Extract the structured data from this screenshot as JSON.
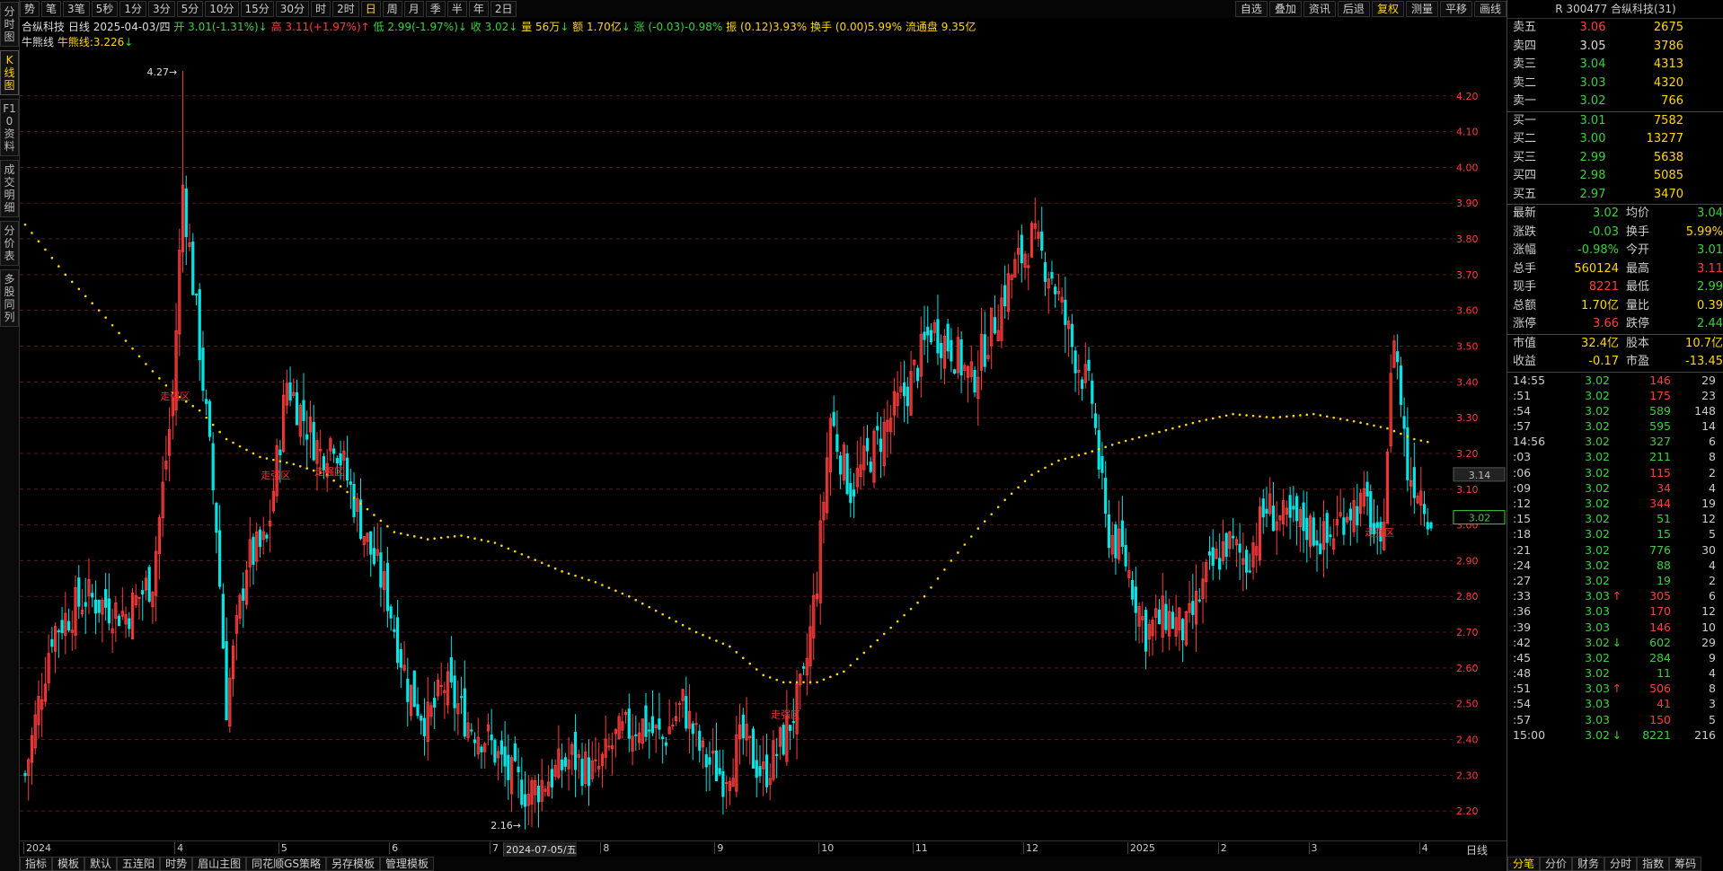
{
  "left_tabs": [
    {
      "label": "分时图",
      "active": false
    },
    {
      "label": "K线图",
      "active": true
    },
    {
      "label": "F10资料",
      "active": false
    },
    {
      "label": "成交明细",
      "active": false
    },
    {
      "label": "分价表",
      "active": false
    },
    {
      "label": "多股同列",
      "active": false
    }
  ],
  "toolbar": {
    "periods": [
      "势",
      "笔",
      "3笔",
      "5秒",
      "1分",
      "3分",
      "5分",
      "10分",
      "15分",
      "30分",
      "时",
      "2时",
      "日",
      "周",
      "月",
      "季",
      "半",
      "年",
      "2日"
    ],
    "active_period": "日",
    "right": [
      "自选",
      "叠加",
      "资讯",
      "后退",
      "复权",
      "测量",
      "平移",
      "画线"
    ],
    "highlight": "复权"
  },
  "info": {
    "name": "合纵科技",
    "period": "日线",
    "date": "2025-04-03/四",
    "open": "开 3.01(-1.31%)",
    "high": "高 3.11(+1.97%)",
    "low": "低 2.99(-1.97%)",
    "close": "收 3.02",
    "volume": "量 56万",
    "amount": "额 1.70亿",
    "change": "涨 (-0.03)-0.98%",
    "amplitude": "振 (0.12)3.93%",
    "turnover": "换手 (0.00)5.99%",
    "float": "流通盘 9.35亿",
    "indicator_name": "牛熊线",
    "indicator_value": "牛熊线:3.226"
  },
  "chart_data": {
    "type": "candlestick",
    "ylim": [
      2.12,
      4.33
    ],
    "y_ticks": [
      "4.20",
      "4.10",
      "4.00",
      "3.90",
      "3.80",
      "3.70",
      "3.60",
      "3.50",
      "3.40",
      "3.30",
      "3.20",
      "3.10",
      "3.00",
      "2.90",
      "2.80",
      "2.70",
      "2.60",
      "2.50",
      "2.40",
      "2.30",
      "2.20"
    ],
    "x_labels": [
      {
        "label": "2024",
        "idx": 0
      },
      {
        "label": "4",
        "idx": 45
      },
      {
        "label": "5",
        "idx": 76
      },
      {
        "label": "6",
        "idx": 109
      },
      {
        "label": "7",
        "idx": 139
      },
      {
        "label": "2024-07-05/五",
        "idx": 143
      },
      {
        "label": "8",
        "idx": 172
      },
      {
        "label": "9",
        "idx": 206
      },
      {
        "label": "10",
        "idx": 237
      },
      {
        "label": "11",
        "idx": 265
      },
      {
        "label": "12",
        "idx": 298
      },
      {
        "label": "2025",
        "idx": 329
      },
      {
        "label": "2",
        "idx": 356
      },
      {
        "label": "3",
        "idx": 383
      },
      {
        "label": "4",
        "idx": 416
      }
    ],
    "n_bars": 420,
    "close_anchors": [
      [
        0,
        2.3
      ],
      [
        8,
        2.7
      ],
      [
        18,
        2.8
      ],
      [
        30,
        2.75
      ],
      [
        38,
        2.85
      ],
      [
        44,
        3.35
      ],
      [
        47,
        3.95
      ],
      [
        52,
        3.5
      ],
      [
        57,
        3.0
      ],
      [
        60,
        2.5
      ],
      [
        66,
        2.9
      ],
      [
        72,
        2.95
      ],
      [
        78,
        3.4
      ],
      [
        83,
        3.3
      ],
      [
        88,
        3.2
      ],
      [
        92,
        3.25
      ],
      [
        97,
        3.1
      ],
      [
        102,
        2.95
      ],
      [
        108,
        2.8
      ],
      [
        114,
        2.55
      ],
      [
        120,
        2.45
      ],
      [
        125,
        2.55
      ],
      [
        132,
        2.45
      ],
      [
        138,
        2.4
      ],
      [
        144,
        2.3
      ],
      [
        150,
        2.25
      ],
      [
        157,
        2.3
      ],
      [
        163,
        2.35
      ],
      [
        170,
        2.3
      ],
      [
        176,
        2.4
      ],
      [
        183,
        2.45
      ],
      [
        190,
        2.4
      ],
      [
        196,
        2.5
      ],
      [
        202,
        2.35
      ],
      [
        208,
        2.3
      ],
      [
        214,
        2.4
      ],
      [
        220,
        2.3
      ],
      [
        226,
        2.4
      ],
      [
        232,
        2.55
      ],
      [
        236,
        2.85
      ],
      [
        240,
        3.3
      ],
      [
        246,
        3.1
      ],
      [
        252,
        3.2
      ],
      [
        258,
        3.3
      ],
      [
        264,
        3.4
      ],
      [
        270,
        3.55
      ],
      [
        276,
        3.5
      ],
      [
        282,
        3.4
      ],
      [
        288,
        3.55
      ],
      [
        294,
        3.7
      ],
      [
        300,
        3.8
      ],
      [
        306,
        3.7
      ],
      [
        312,
        3.5
      ],
      [
        318,
        3.35
      ],
      [
        322,
        3.0
      ],
      [
        328,
        2.9
      ],
      [
        334,
        2.7
      ],
      [
        340,
        2.75
      ],
      [
        346,
        2.7
      ],
      [
        352,
        2.85
      ],
      [
        358,
        2.95
      ],
      [
        364,
        2.9
      ],
      [
        370,
        3.05
      ],
      [
        376,
        3.0
      ],
      [
        382,
        3.0
      ],
      [
        388,
        2.95
      ],
      [
        394,
        3.05
      ],
      [
        400,
        3.05
      ],
      [
        404,
        2.9
      ],
      [
        408,
        3.55
      ],
      [
        412,
        3.15
      ],
      [
        416,
        3.1
      ],
      [
        419,
        3.02
      ]
    ],
    "ma_anchors": [
      [
        0,
        3.84
      ],
      [
        12,
        3.7
      ],
      [
        24,
        3.58
      ],
      [
        36,
        3.45
      ],
      [
        44,
        3.37
      ],
      [
        52,
        3.32
      ],
      [
        60,
        3.24
      ],
      [
        70,
        3.19
      ],
      [
        80,
        3.17
      ],
      [
        90,
        3.14
      ],
      [
        100,
        3.06
      ],
      [
        110,
        2.98
      ],
      [
        120,
        2.96
      ],
      [
        130,
        2.97
      ],
      [
        140,
        2.95
      ],
      [
        150,
        2.91
      ],
      [
        160,
        2.87
      ],
      [
        170,
        2.84
      ],
      [
        180,
        2.8
      ],
      [
        190,
        2.75
      ],
      [
        200,
        2.7
      ],
      [
        210,
        2.66
      ],
      [
        220,
        2.58
      ],
      [
        226,
        2.56
      ],
      [
        236,
        2.56
      ],
      [
        244,
        2.59
      ],
      [
        252,
        2.66
      ],
      [
        260,
        2.73
      ],
      [
        268,
        2.8
      ],
      [
        276,
        2.9
      ],
      [
        284,
        2.99
      ],
      [
        292,
        3.07
      ],
      [
        300,
        3.14
      ],
      [
        308,
        3.18
      ],
      [
        316,
        3.2
      ],
      [
        326,
        3.23
      ],
      [
        338,
        3.26
      ],
      [
        350,
        3.29
      ],
      [
        360,
        3.31
      ],
      [
        372,
        3.3
      ],
      [
        384,
        3.31
      ],
      [
        396,
        3.29
      ],
      [
        406,
        3.27
      ],
      [
        414,
        3.24
      ],
      [
        419,
        3.23
      ]
    ],
    "high_label": "4.27",
    "low_label": "2.16",
    "zone_labels": [
      {
        "text": "走强区",
        "idx": 44,
        "price": 3.35
      },
      {
        "text": "走强区",
        "idx": 74,
        "price": 3.13
      },
      {
        "text": "走强区",
        "idx": 90,
        "price": 3.14
      },
      {
        "text": "走强区",
        "idx": 226,
        "price": 2.46
      },
      {
        "text": "走强区",
        "idx": 403,
        "price": 2.97
      }
    ],
    "current_price_mark": "3.02",
    "cross_price_mark": "3.14"
  },
  "bottom_tabs": [
    "指标",
    "模板",
    "默认",
    "五连阳",
    "时势",
    "眉山主图",
    "同花顺GS策略",
    "另存模板",
    "管理模板"
  ],
  "x_right_label": "日线",
  "side": {
    "title": "R 300477 合纵科技(31)",
    "sells": [
      {
        "label": "卖五",
        "price": "3.06",
        "vol": "2675",
        "color": "red"
      },
      {
        "label": "卖四",
        "price": "3.05",
        "vol": "3786",
        "color": "white"
      },
      {
        "label": "卖三",
        "price": "3.04",
        "vol": "4313",
        "color": "green"
      },
      {
        "label": "卖二",
        "price": "3.03",
        "vol": "4320",
        "color": "green"
      },
      {
        "label": "卖一",
        "price": "3.02",
        "vol": "766",
        "color": "green"
      }
    ],
    "buys": [
      {
        "label": "买一",
        "price": "3.01",
        "vol": "7582",
        "color": "green"
      },
      {
        "label": "买二",
        "price": "3.00",
        "vol": "13277",
        "color": "green"
      },
      {
        "label": "买三",
        "price": "2.99",
        "vol": "5638",
        "color": "green"
      },
      {
        "label": "买四",
        "price": "2.98",
        "vol": "5085",
        "color": "green"
      },
      {
        "label": "买五",
        "price": "2.97",
        "vol": "3470",
        "color": "green"
      }
    ],
    "stats": [
      {
        "l1": "最新",
        "v1": "3.02",
        "c1": "green",
        "l2": "均价",
        "v2": "3.04",
        "c2": "green"
      },
      {
        "l1": "涨跌",
        "v1": "-0.03",
        "c1": "green",
        "l2": "换手",
        "v2": "5.99%",
        "c2": "yellow"
      },
      {
        "l1": "涨幅",
        "v1": "-0.98%",
        "c1": "green",
        "l2": "今开",
        "v2": "3.01",
        "c2": "green"
      },
      {
        "l1": "总手",
        "v1": "560124",
        "c1": "yellow",
        "l2": "最高",
        "v2": "3.11",
        "c2": "red"
      },
      {
        "l1": "现手",
        "v1": "8221",
        "c1": "red",
        "l2": "最低",
        "v2": "2.99",
        "c2": "green"
      },
      {
        "l1": "总额",
        "v1": "1.70亿",
        "c1": "yellow",
        "l2": "量比",
        "v2": "0.39",
        "c2": "yellow"
      },
      {
        "l1": "涨停",
        "v1": "3.66",
        "c1": "red",
        "l2": "跌停",
        "v2": "2.44",
        "c2": "green"
      }
    ],
    "stats2": [
      {
        "l1": "市值",
        "v1": "32.4亿",
        "c1": "yellow",
        "l2": "股本",
        "v2": "10.7亿",
        "c2": "yellow"
      },
      {
        "l1": "收益",
        "v1": "-0.17",
        "c1": "yellow",
        "l2": "市盈",
        "v2": "-13.45",
        "c2": "yellow"
      }
    ],
    "ticks": [
      {
        "t": "14:55",
        "p": "3.02",
        "pc": "green",
        "a": "",
        "v": "146",
        "vc": "red",
        "n": "29"
      },
      {
        "t": ":51",
        "p": "3.02",
        "pc": "green",
        "a": "",
        "v": "175",
        "vc": "red",
        "n": "23"
      },
      {
        "t": ":54",
        "p": "3.02",
        "pc": "green",
        "a": "",
        "v": "589",
        "vc": "green",
        "n": "148"
      },
      {
        "t": ":57",
        "p": "3.02",
        "pc": "green",
        "a": "",
        "v": "595",
        "vc": "green",
        "n": "14"
      },
      {
        "t": "14:56",
        "p": "3.02",
        "pc": "green",
        "a": "",
        "v": "327",
        "vc": "green",
        "n": "6"
      },
      {
        "t": ":03",
        "p": "3.02",
        "pc": "green",
        "a": "",
        "v": "211",
        "vc": "green",
        "n": "8"
      },
      {
        "t": ":06",
        "p": "3.02",
        "pc": "green",
        "a": "",
        "v": "115",
        "vc": "red",
        "n": "2"
      },
      {
        "t": ":09",
        "p": "3.02",
        "pc": "green",
        "a": "",
        "v": "34",
        "vc": "red",
        "n": "4"
      },
      {
        "t": ":12",
        "p": "3.02",
        "pc": "green",
        "a": "",
        "v": "344",
        "vc": "red",
        "n": "19"
      },
      {
        "t": ":15",
        "p": "3.02",
        "pc": "green",
        "a": "",
        "v": "51",
        "vc": "green",
        "n": "12"
      },
      {
        "t": ":18",
        "p": "3.02",
        "pc": "green",
        "a": "",
        "v": "15",
        "vc": "green",
        "n": "5"
      },
      {
        "t": ":21",
        "p": "3.02",
        "pc": "green",
        "a": "",
        "v": "776",
        "vc": "green",
        "n": "30"
      },
      {
        "t": ":24",
        "p": "3.02",
        "pc": "green",
        "a": "",
        "v": "88",
        "vc": "green",
        "n": "4"
      },
      {
        "t": ":27",
        "p": "3.02",
        "pc": "green",
        "a": "",
        "v": "19",
        "vc": "green",
        "n": "2"
      },
      {
        "t": ":33",
        "p": "3.03",
        "pc": "green",
        "a": "↑",
        "ac": "red",
        "v": "305",
        "vc": "red",
        "n": "6"
      },
      {
        "t": ":36",
        "p": "3.03",
        "pc": "green",
        "a": "",
        "v": "170",
        "vc": "red",
        "n": "12"
      },
      {
        "t": ":39",
        "p": "3.03",
        "pc": "green",
        "a": "",
        "v": "146",
        "vc": "red",
        "n": "10"
      },
      {
        "t": ":42",
        "p": "3.02",
        "pc": "green",
        "a": "↓",
        "ac": "green",
        "v": "602",
        "vc": "green",
        "n": "29"
      },
      {
        "t": ":45",
        "p": "3.02",
        "pc": "green",
        "a": "",
        "v": "284",
        "vc": "green",
        "n": "9"
      },
      {
        "t": ":48",
        "p": "3.02",
        "pc": "green",
        "a": "",
        "v": "11",
        "vc": "green",
        "n": "4"
      },
      {
        "t": ":51",
        "p": "3.03",
        "pc": "green",
        "a": "↑",
        "ac": "red",
        "v": "506",
        "vc": "red",
        "n": "8"
      },
      {
        "t": ":54",
        "p": "3.03",
        "pc": "green",
        "a": "",
        "v": "41",
        "vc": "red",
        "n": "3"
      },
      {
        "t": ":57",
        "p": "3.03",
        "pc": "green",
        "a": "",
        "v": "150",
        "vc": "red",
        "n": "5"
      },
      {
        "t": "15:00",
        "p": "3.02",
        "pc": "green",
        "a": "↓",
        "ac": "green",
        "v": "8221",
        "vc": "green",
        "n": "216"
      }
    ],
    "tabs": [
      "分笔",
      "分价",
      "财务",
      "分时",
      "指数",
      "筹码"
    ],
    "active_tab": "分笔"
  },
  "colors": {
    "up": "#ff3c3c",
    "down": "#00e5e5",
    "ma": "#ffd700",
    "grid": "#5a1a1a"
  }
}
